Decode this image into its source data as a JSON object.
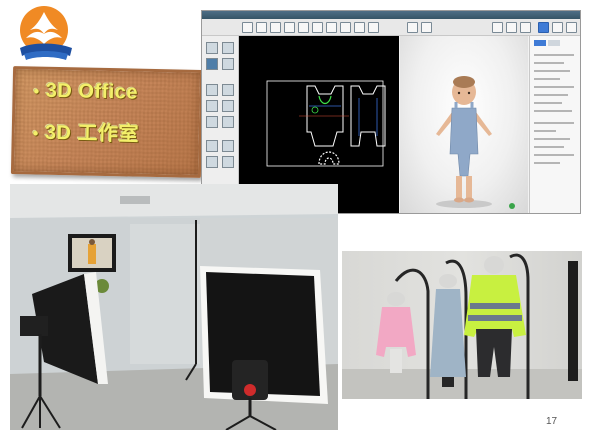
{
  "slide": {
    "title_lines": [
      "3D Office",
      "3D 工作室"
    ],
    "bullet": "•",
    "page_number": "17"
  },
  "software": {
    "window_title": "",
    "pattern_caption": "",
    "avatar_label": "",
    "colors": {
      "pattern_bg": "#000000",
      "pattern_line": "#ffffff",
      "selected_line": "#3ee04a",
      "garment_blue": "#8fa8c8"
    }
  },
  "photos": {
    "studio": {
      "icons": [
        "softbox-icon",
        "tripod-icon",
        "monitor-icon"
      ]
    },
    "mannequins": {
      "garments": [
        "pink-shirt",
        "grey-dress",
        "hi-vis-shirt"
      ],
      "colors": {
        "pink": "#f2a8c4",
        "grey_blue": "#9fb4c6",
        "hi_vis": "#c8f040",
        "hi_vis_stripe": "#6b7a8c",
        "trousers": "#2c2c2e"
      }
    }
  }
}
